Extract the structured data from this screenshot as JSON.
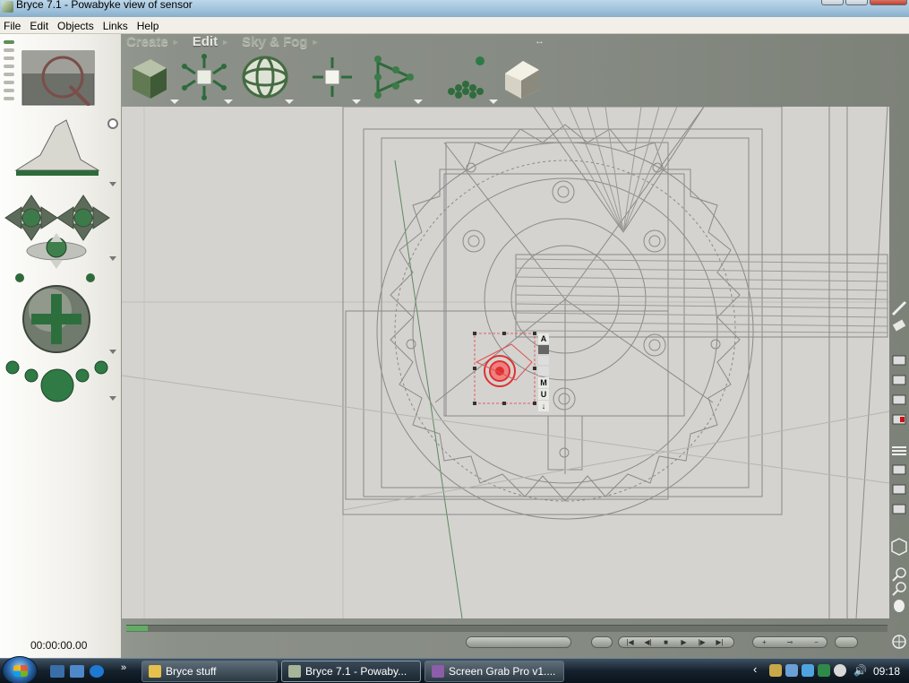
{
  "window": {
    "title": "Bryce 7.1  - Powabyke view of sensor"
  },
  "menu": [
    "File",
    "Edit",
    "Objects",
    "Links",
    "Help"
  ],
  "palette_tabs": [
    {
      "label": "Create",
      "active": false
    },
    {
      "label": "Edit",
      "active": true
    },
    {
      "label": "Sky & Fog",
      "active": false
    }
  ],
  "toolbar_tools": [
    {
      "name": "material-lab-icon"
    },
    {
      "name": "resize-icon"
    },
    {
      "name": "rotate-icon"
    },
    {
      "name": "reposition-icon"
    },
    {
      "name": "align-icon"
    },
    {
      "name": "randomize-icon"
    },
    {
      "name": "terrain-edit-icon"
    }
  ],
  "object_tools": [
    "A",
    "M",
    "U"
  ],
  "timecode": "00:00:00.00",
  "taskbar": {
    "tasks": [
      {
        "label": "Bryce stuff",
        "active": false
      },
      {
        "label": "Bryce 7.1  - Powaby...",
        "active": true
      },
      {
        "label": "Screen Grab Pro v1....",
        "active": false
      }
    ],
    "clock": "09:18"
  },
  "colors": {
    "accent": "#5f7e4e",
    "selection": "#e03030",
    "wireframe": "#8a8a88"
  }
}
